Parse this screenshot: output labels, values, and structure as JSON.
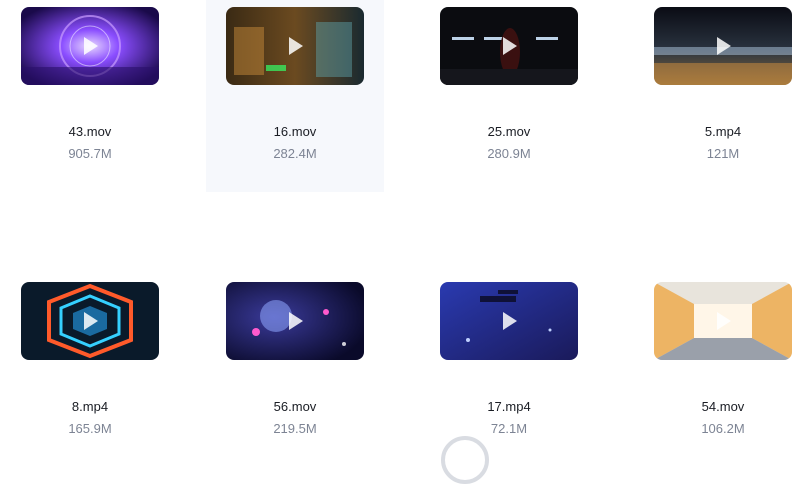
{
  "files": [
    {
      "name": "43.mov",
      "size": "905.7M",
      "hovered": false
    },
    {
      "name": "16.mov",
      "size": "282.4M",
      "hovered": true
    },
    {
      "name": "25.mov",
      "size": "280.9M",
      "hovered": false
    },
    {
      "name": "5.mp4",
      "size": "121M",
      "hovered": false
    },
    {
      "name": "8.mp4",
      "size": "165.9M",
      "hovered": false
    },
    {
      "name": "56.mov",
      "size": "219.5M",
      "hovered": false
    },
    {
      "name": "17.mp4",
      "size": "72.1M",
      "hovered": false
    },
    {
      "name": "54.mov",
      "size": "106.2M",
      "hovered": false
    }
  ],
  "icons": {
    "play": "play-icon",
    "loading": "loading-spinner-icon"
  },
  "colors": {
    "hover_background": "#f6f8fc",
    "name_text": "#1a1d24",
    "size_text": "#7d8494"
  }
}
